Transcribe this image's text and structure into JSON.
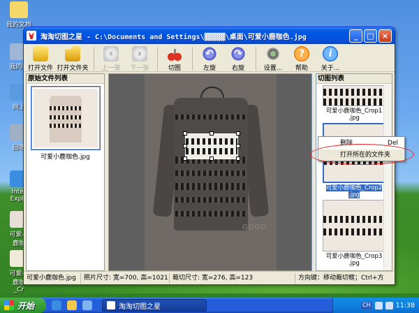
{
  "desktop": {
    "icons": [
      {
        "label": "我的文档",
        "color": "#f5d86a"
      },
      {
        "label": "我的电",
        "color": "#9fb6d6"
      },
      {
        "label": "网上",
        "color": "#5a9be0"
      },
      {
        "label": "回收",
        "color": "#9fb0c4"
      },
      {
        "label": "Inter\nExplo",
        "color": "#3a8de0"
      },
      {
        "label": "可爱小\n鹿咖",
        "color": "#e8e0d8"
      },
      {
        "label": "可爱小\n鹿咖\n_Cr",
        "color": "#f0ead8"
      }
    ]
  },
  "window": {
    "title": "淘淘切图之星 - C:\\Documents and Settings\\▓▓▓▓▓\\桌面\\可爱小鹿咖色.jpg",
    "controls": {
      "minimize": "_",
      "maximize": "□",
      "close": "×"
    }
  },
  "toolbar": {
    "open_file": "打开文件",
    "open_folder": "打开文件夹",
    "prev": "上一张",
    "next": "下一张",
    "cut": "切图",
    "rotate_left": "左旋",
    "rotate_right": "右旋",
    "settings": "设置...",
    "help": "帮助",
    "about": "关于..."
  },
  "left_panel": {
    "title": "原始文件列表",
    "files": [
      {
        "name": "可爱小鹿咖色.jpg",
        "selected": true
      }
    ]
  },
  "right_panel": {
    "title": "切图列表",
    "crops": [
      {
        "name_line1": "可爱小鹿咖色_Crop1",
        "name_line2": ".jpg",
        "selected": false
      },
      {
        "name_line1": "可爱小鹿咖色_Crop2",
        "name_line2": ".jpg",
        "selected": true
      },
      {
        "name_line1": "可爱小鹿咖色_Crop3",
        "name_line2": ".jpg",
        "selected": false
      }
    ]
  },
  "context_menu": {
    "delete_label": "删除",
    "delete_shortcut": "Del",
    "open_folder_label": "打开所在的文件夹"
  },
  "watermark": "GOGO",
  "statusbar": {
    "filename": "可爱小鹿咖色.jpg",
    "photo_size": "照片尺寸: 宽=700, 高=1021",
    "crop_size": "裁切尺寸: 宽=276, 高=123",
    "hint": "方向键：移动裁切框；Ctrl+方"
  },
  "taskbar": {
    "start_label": "开始",
    "task_label": "淘淘切图之星",
    "clock": "11:38",
    "lang": "CH"
  },
  "colors": {
    "accent": "#0054e3",
    "selection": "#3169c6",
    "highlight_oval": "#ee2222"
  }
}
